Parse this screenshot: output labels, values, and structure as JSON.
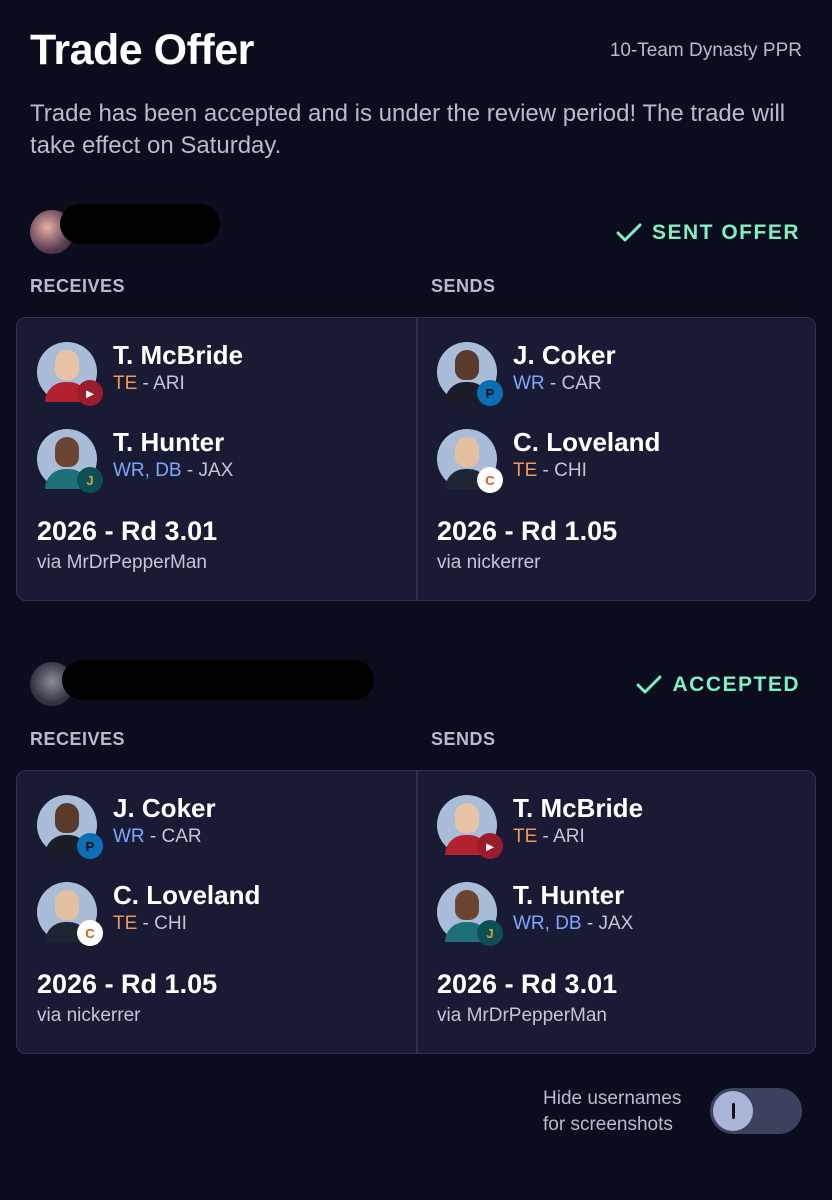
{
  "header": {
    "title": "Trade Offer",
    "league": "10-Team Dynasty PPR",
    "description": "Trade has been accepted and is under the review period! The trade will take effect on Saturday."
  },
  "labels": {
    "receives": "RECEIVES",
    "sends": "SENDS"
  },
  "teams": [
    {
      "status": "SENT OFFER",
      "receives": {
        "players": [
          {
            "name": "T. McBride",
            "pos": "TE",
            "team": " - ARI",
            "logo": "cardinals-logo"
          },
          {
            "name": "T. Hunter",
            "pos": "WR, DB",
            "team": " - JAX",
            "logo": "jaguars-logo"
          }
        ],
        "pick": "2026 - Rd 3.01",
        "via": "via MrDrPepperMan"
      },
      "sends": {
        "players": [
          {
            "name": "J. Coker",
            "pos": "WR",
            "team": " - CAR",
            "logo": "panthers-logo"
          },
          {
            "name": "C. Loveland",
            "pos": "TE",
            "team": " - CHI",
            "logo": "bears-logo"
          }
        ],
        "pick": "2026 - Rd 1.05",
        "via": "via nickerrer"
      }
    },
    {
      "status": "ACCEPTED",
      "receives": {
        "players": [
          {
            "name": "J. Coker",
            "pos": "WR",
            "team": " - CAR",
            "logo": "panthers-logo"
          },
          {
            "name": "C. Loveland",
            "pos": "TE",
            "team": " - CHI",
            "logo": "bears-logo"
          }
        ],
        "pick": "2026 - Rd 1.05",
        "via": "via nickerrer"
      },
      "sends": {
        "players": [
          {
            "name": "T. McBride",
            "pos": "TE",
            "team": " - ARI",
            "logo": "cardinals-logo"
          },
          {
            "name": "T. Hunter",
            "pos": "WR, DB",
            "team": " - JAX",
            "logo": "jaguars-logo"
          }
        ],
        "pick": "2026 - Rd 3.01",
        "via": "via MrDrPepperMan"
      }
    }
  ],
  "footer": {
    "hide_label_1": "Hide usernames",
    "hide_label_2": "for screenshots",
    "toggle_on": false
  },
  "colors": {
    "accent": "#7ef0c2",
    "background": "#0b0d1e",
    "card": "#181b33",
    "position_wr": "#7fa6ff",
    "position_te": "#ef9a5a"
  }
}
